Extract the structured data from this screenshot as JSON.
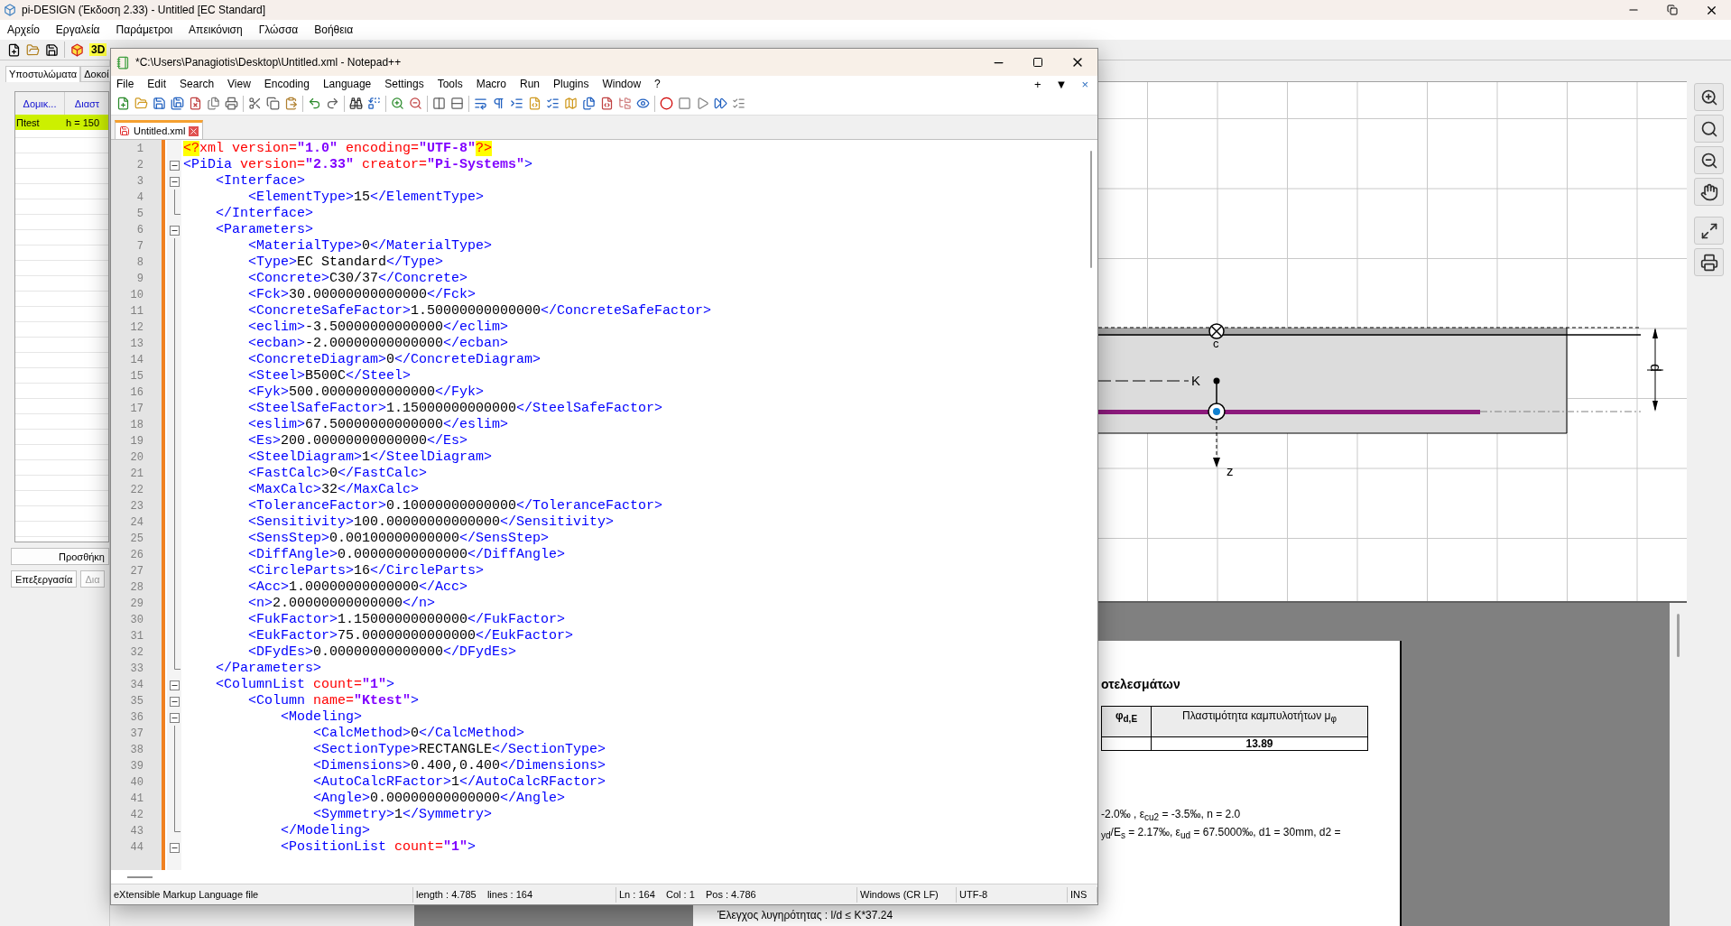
{
  "app": {
    "title": "pi-DESIGN (Έκδοση 2.33) - Untitled [EC Standard]",
    "menu": [
      "Αρχείο",
      "Εργαλεία",
      "Παράμετροι",
      "Απεικόνιση",
      "Γλώσσα",
      "Βοήθεια"
    ],
    "toolbar_label": "3D"
  },
  "left_panel": {
    "tabs": [
      {
        "label": "Υποστυλώματα",
        "selected": true
      },
      {
        "label": "Δοκοί",
        "selected": false
      }
    ],
    "columns": [
      "Δομικ...",
      "Διαστ"
    ],
    "rows": [
      {
        "cells": [
          "Πtest",
          "h = 150"
        ],
        "selected": true
      }
    ],
    "buttons": [
      "Προσθήκη",
      "Επεξεργασία",
      "Δια"
    ]
  },
  "canvas": {
    "labels": {
      "centroid": "c",
      "point": "K",
      "axis": "z",
      "dimension": "d"
    }
  },
  "report": {
    "heading": "οτελεσμάτων",
    "table": {
      "columns": [
        "φ$_{d,E}$",
        "Πλαστιμότητα καμπυλοτήτων μ$_{φ}$"
      ],
      "rows": [
        {
          "column_2": "13.89"
        }
      ]
    },
    "lines": [
      "-2.0‰ , ε$_{cu2}$ = -3.5‰, n = 2.0",
      "$_{yd}$/E$_{s}$ = 2.17‰, ε$_{ud}$ = 67.5000‰, d1 = 30mm, d2 ="
    ],
    "footer": "Έλεγχος λυγηρότητας : l/d ≤ K*37.24"
  },
  "editor": {
    "title": "*C:\\Users\\Panagiotis\\Desktop\\Untitled.xml - Notepad++",
    "menu": [
      "File",
      "Edit",
      "Search",
      "View",
      "Encoding",
      "Language",
      "Settings",
      "Tools",
      "Macro",
      "Run",
      "Plugins",
      "Window",
      "?"
    ],
    "menu_right": [
      "+",
      "▼",
      "×"
    ],
    "tabs": [
      {
        "label": "Untitled.xml",
        "selected": true
      }
    ],
    "lines": [
      {
        "number": "1",
        "kind": "plain",
        "tokens": [
          {
            "kind": "pi",
            "text": "<?"
          },
          {
            "kind": "attr",
            "text": "xml version="
          },
          {
            "kind": "value",
            "text": "\"1.0\""
          },
          {
            "kind": "attr",
            "text": " encoding="
          },
          {
            "kind": "value",
            "text": "\"UTF-8\""
          },
          {
            "kind": "pi",
            "text": "?>"
          }
        ]
      },
      {
        "number": "2",
        "kind": "fold-start",
        "tokens": [
          {
            "kind": "tag",
            "text": "<PiDia"
          },
          {
            "kind": "attr",
            "text": " version="
          },
          {
            "kind": "value",
            "text": "\"2.33\""
          },
          {
            "kind": "attr",
            "text": " creator="
          },
          {
            "kind": "value",
            "text": "\"Pi-Systems\""
          },
          {
            "kind": "tag",
            "text": ">"
          }
        ]
      },
      {
        "number": "3",
        "kind": "fold-start",
        "tokens": [
          {
            "kind": "tag",
            "text": "    <Interface>"
          }
        ]
      },
      {
        "number": "4",
        "kind": "fold-body",
        "tokens": [
          {
            "kind": "tag",
            "text": "        <ElementType>"
          },
          {
            "kind": "text",
            "text": "15"
          },
          {
            "kind": "tag",
            "text": "</ElementType>"
          }
        ]
      },
      {
        "number": "5",
        "kind": "fold-end",
        "tokens": [
          {
            "kind": "tag",
            "text": "    </Interface>"
          }
        ]
      },
      {
        "number": "6",
        "kind": "fold-start",
        "tokens": [
          {
            "kind": "tag",
            "text": "    <Parameters>"
          }
        ]
      },
      {
        "number": "7",
        "kind": "fold-body",
        "tokens": [
          {
            "kind": "tag",
            "text": "        <MaterialType>"
          },
          {
            "kind": "text",
            "text": "0"
          },
          {
            "kind": "tag",
            "text": "</MaterialType>"
          }
        ]
      },
      {
        "number": "8",
        "kind": "fold-body",
        "tokens": [
          {
            "kind": "tag",
            "text": "        <Type>"
          },
          {
            "kind": "text",
            "text": "EC Standard"
          },
          {
            "kind": "tag",
            "text": "</Type>"
          }
        ]
      },
      {
        "number": "9",
        "kind": "fold-body",
        "tokens": [
          {
            "kind": "tag",
            "text": "        <Concrete>"
          },
          {
            "kind": "text",
            "text": "C30/37"
          },
          {
            "kind": "tag",
            "text": "</Concrete>"
          }
        ]
      },
      {
        "number": "10",
        "kind": "fold-body",
        "tokens": [
          {
            "kind": "tag",
            "text": "        <Fck>"
          },
          {
            "kind": "text",
            "text": "30.00000000000000"
          },
          {
            "kind": "tag",
            "text": "</Fck>"
          }
        ]
      },
      {
        "number": "11",
        "kind": "fold-body",
        "tokens": [
          {
            "kind": "tag",
            "text": "        <ConcreteSafeFactor>"
          },
          {
            "kind": "text",
            "text": "1.50000000000000"
          },
          {
            "kind": "tag",
            "text": "</ConcreteSafeFactor>"
          }
        ]
      },
      {
        "number": "12",
        "kind": "fold-body",
        "tokens": [
          {
            "kind": "tag",
            "text": "        <eclim>"
          },
          {
            "kind": "text",
            "text": "-3.50000000000000"
          },
          {
            "kind": "tag",
            "text": "</eclim>"
          }
        ]
      },
      {
        "number": "13",
        "kind": "fold-body",
        "tokens": [
          {
            "kind": "tag",
            "text": "        <ecban>"
          },
          {
            "kind": "text",
            "text": "-2.00000000000000"
          },
          {
            "kind": "tag",
            "text": "</ecban>"
          }
        ]
      },
      {
        "number": "14",
        "kind": "fold-body",
        "tokens": [
          {
            "kind": "tag",
            "text": "        <ConcreteDiagram>"
          },
          {
            "kind": "text",
            "text": "0"
          },
          {
            "kind": "tag",
            "text": "</ConcreteDiagram>"
          }
        ]
      },
      {
        "number": "15",
        "kind": "fold-body",
        "tokens": [
          {
            "kind": "tag",
            "text": "        <Steel>"
          },
          {
            "kind": "text",
            "text": "B500C"
          },
          {
            "kind": "tag",
            "text": "</Steel>"
          }
        ]
      },
      {
        "number": "16",
        "kind": "fold-body",
        "tokens": [
          {
            "kind": "tag",
            "text": "        <Fyk>"
          },
          {
            "kind": "text",
            "text": "500.00000000000000"
          },
          {
            "kind": "tag",
            "text": "</Fyk>"
          }
        ]
      },
      {
        "number": "17",
        "kind": "fold-body",
        "tokens": [
          {
            "kind": "tag",
            "text": "        <SteelSafeFactor>"
          },
          {
            "kind": "text",
            "text": "1.15000000000000"
          },
          {
            "kind": "tag",
            "text": "</SteelSafeFactor>"
          }
        ]
      },
      {
        "number": "18",
        "kind": "fold-body",
        "tokens": [
          {
            "kind": "tag",
            "text": "        <eslim>"
          },
          {
            "kind": "text",
            "text": "67.50000000000000"
          },
          {
            "kind": "tag",
            "text": "</eslim>"
          }
        ]
      },
      {
        "number": "19",
        "kind": "fold-body",
        "tokens": [
          {
            "kind": "tag",
            "text": "        <Es>"
          },
          {
            "kind": "text",
            "text": "200.00000000000000"
          },
          {
            "kind": "tag",
            "text": "</Es>"
          }
        ]
      },
      {
        "number": "20",
        "kind": "fold-body",
        "tokens": [
          {
            "kind": "tag",
            "text": "        <SteelDiagram>"
          },
          {
            "kind": "text",
            "text": "1"
          },
          {
            "kind": "tag",
            "text": "</SteelDiagram>"
          }
        ]
      },
      {
        "number": "21",
        "kind": "fold-body",
        "tokens": [
          {
            "kind": "tag",
            "text": "        <FastCalc>"
          },
          {
            "kind": "text",
            "text": "0"
          },
          {
            "kind": "tag",
            "text": "</FastCalc>"
          }
        ]
      },
      {
        "number": "22",
        "kind": "fold-body",
        "tokens": [
          {
            "kind": "tag",
            "text": "        <MaxCalc>"
          },
          {
            "kind": "text",
            "text": "32"
          },
          {
            "kind": "tag",
            "text": "</MaxCalc>"
          }
        ]
      },
      {
        "number": "23",
        "kind": "fold-body",
        "tokens": [
          {
            "kind": "tag",
            "text": "        <ToleranceFactor>"
          },
          {
            "kind": "text",
            "text": "0.10000000000000"
          },
          {
            "kind": "tag",
            "text": "</ToleranceFactor>"
          }
        ]
      },
      {
        "number": "24",
        "kind": "fold-body",
        "tokens": [
          {
            "kind": "tag",
            "text": "        <Sensitivity>"
          },
          {
            "kind": "text",
            "text": "100.00000000000000"
          },
          {
            "kind": "tag",
            "text": "</Sensitivity>"
          }
        ]
      },
      {
        "number": "25",
        "kind": "fold-body",
        "tokens": [
          {
            "kind": "tag",
            "text": "        <SensStep>"
          },
          {
            "kind": "text",
            "text": "0.00100000000000"
          },
          {
            "kind": "tag",
            "text": "</SensStep>"
          }
        ]
      },
      {
        "number": "26",
        "kind": "fold-body",
        "tokens": [
          {
            "kind": "tag",
            "text": "        <DiffAngle>"
          },
          {
            "kind": "text",
            "text": "0.00000000000000"
          },
          {
            "kind": "tag",
            "text": "</DiffAngle>"
          }
        ]
      },
      {
        "number": "27",
        "kind": "fold-body",
        "tokens": [
          {
            "kind": "tag",
            "text": "        <CircleParts>"
          },
          {
            "kind": "text",
            "text": "16"
          },
          {
            "kind": "tag",
            "text": "</CircleParts>"
          }
        ]
      },
      {
        "number": "28",
        "kind": "fold-body",
        "tokens": [
          {
            "kind": "tag",
            "text": "        <Acc>"
          },
          {
            "kind": "text",
            "text": "1.00000000000000"
          },
          {
            "kind": "tag",
            "text": "</Acc>"
          }
        ]
      },
      {
        "number": "29",
        "kind": "fold-body",
        "tokens": [
          {
            "kind": "tag",
            "text": "        <n>"
          },
          {
            "kind": "text",
            "text": "2.00000000000000"
          },
          {
            "kind": "tag",
            "text": "</n>"
          }
        ]
      },
      {
        "number": "30",
        "kind": "fold-body",
        "tokens": [
          {
            "kind": "tag",
            "text": "        <FukFactor>"
          },
          {
            "kind": "text",
            "text": "1.15000000000000"
          },
          {
            "kind": "tag",
            "text": "</FukFactor>"
          }
        ]
      },
      {
        "number": "31",
        "kind": "fold-body",
        "tokens": [
          {
            "kind": "tag",
            "text": "        <EukFactor>"
          },
          {
            "kind": "text",
            "text": "75.00000000000000"
          },
          {
            "kind": "tag",
            "text": "</EukFactor>"
          }
        ]
      },
      {
        "number": "32",
        "kind": "fold-body",
        "tokens": [
          {
            "kind": "tag",
            "text": "        <DFydEs>"
          },
          {
            "kind": "text",
            "text": "0.00000000000000"
          },
          {
            "kind": "tag",
            "text": "</DFydEs>"
          }
        ]
      },
      {
        "number": "33",
        "kind": "fold-end",
        "tokens": [
          {
            "kind": "tag",
            "text": "    </Parameters>"
          }
        ]
      },
      {
        "number": "34",
        "kind": "fold-start",
        "tokens": [
          {
            "kind": "tag",
            "text": "    <ColumnList"
          },
          {
            "kind": "attr",
            "text": " count="
          },
          {
            "kind": "value",
            "text": "\"1\""
          },
          {
            "kind": "tag",
            "text": ">"
          }
        ]
      },
      {
        "number": "35",
        "kind": "fold-start",
        "tokens": [
          {
            "kind": "tag",
            "text": "        <Column"
          },
          {
            "kind": "attr",
            "text": " name="
          },
          {
            "kind": "value",
            "text": "\"Ktest\""
          },
          {
            "kind": "tag",
            "text": ">"
          }
        ]
      },
      {
        "number": "36",
        "kind": "fold-start",
        "tokens": [
          {
            "kind": "tag",
            "text": "            <Modeling>"
          }
        ]
      },
      {
        "number": "37",
        "kind": "fold-body",
        "tokens": [
          {
            "kind": "tag",
            "text": "                <CalcMethod>"
          },
          {
            "kind": "text",
            "text": "0"
          },
          {
            "kind": "tag",
            "text": "</CalcMethod>"
          }
        ]
      },
      {
        "number": "38",
        "kind": "fold-body",
        "tokens": [
          {
            "kind": "tag",
            "text": "                <SectionType>"
          },
          {
            "kind": "text",
            "text": "RECTANGLE"
          },
          {
            "kind": "tag",
            "text": "</SectionType>"
          }
        ]
      },
      {
        "number": "39",
        "kind": "fold-body",
        "tokens": [
          {
            "kind": "tag",
            "text": "                <Dimensions>"
          },
          {
            "kind": "text",
            "text": "0.400,0.400"
          },
          {
            "kind": "tag",
            "text": "</Dimensions>"
          }
        ]
      },
      {
        "number": "40",
        "kind": "fold-body",
        "tokens": [
          {
            "kind": "tag",
            "text": "                <AutoCalcRFactor>"
          },
          {
            "kind": "text",
            "text": "1"
          },
          {
            "kind": "tag",
            "text": "</AutoCalcRFactor>"
          }
        ]
      },
      {
        "number": "41",
        "kind": "fold-body",
        "tokens": [
          {
            "kind": "tag",
            "text": "                <Angle>"
          },
          {
            "kind": "text",
            "text": "0.00000000000000"
          },
          {
            "kind": "tag",
            "text": "</Angle>"
          }
        ]
      },
      {
        "number": "42",
        "kind": "fold-body",
        "tokens": [
          {
            "kind": "tag",
            "text": "                <Symmetry>"
          },
          {
            "kind": "text",
            "text": "1"
          },
          {
            "kind": "tag",
            "text": "</Symmetry>"
          }
        ]
      },
      {
        "number": "43",
        "kind": "fold-end",
        "tokens": [
          {
            "kind": "tag",
            "text": "            </Modeling>"
          }
        ]
      },
      {
        "number": "44",
        "kind": "fold-start",
        "tokens": [
          {
            "kind": "tag",
            "text": "            <PositionList"
          },
          {
            "kind": "attr",
            "text": " count="
          },
          {
            "kind": "value",
            "text": "\"1\""
          },
          {
            "kind": "tag",
            "text": ">"
          }
        ]
      }
    ],
    "status": [
      "eXtensible Markup Language file",
      "length : 4.785    lines : 164",
      "Ln : 164    Col : 1    Pos : 4.786",
      "Windows (CR LF)",
      "UTF-8",
      "INS"
    ]
  }
}
